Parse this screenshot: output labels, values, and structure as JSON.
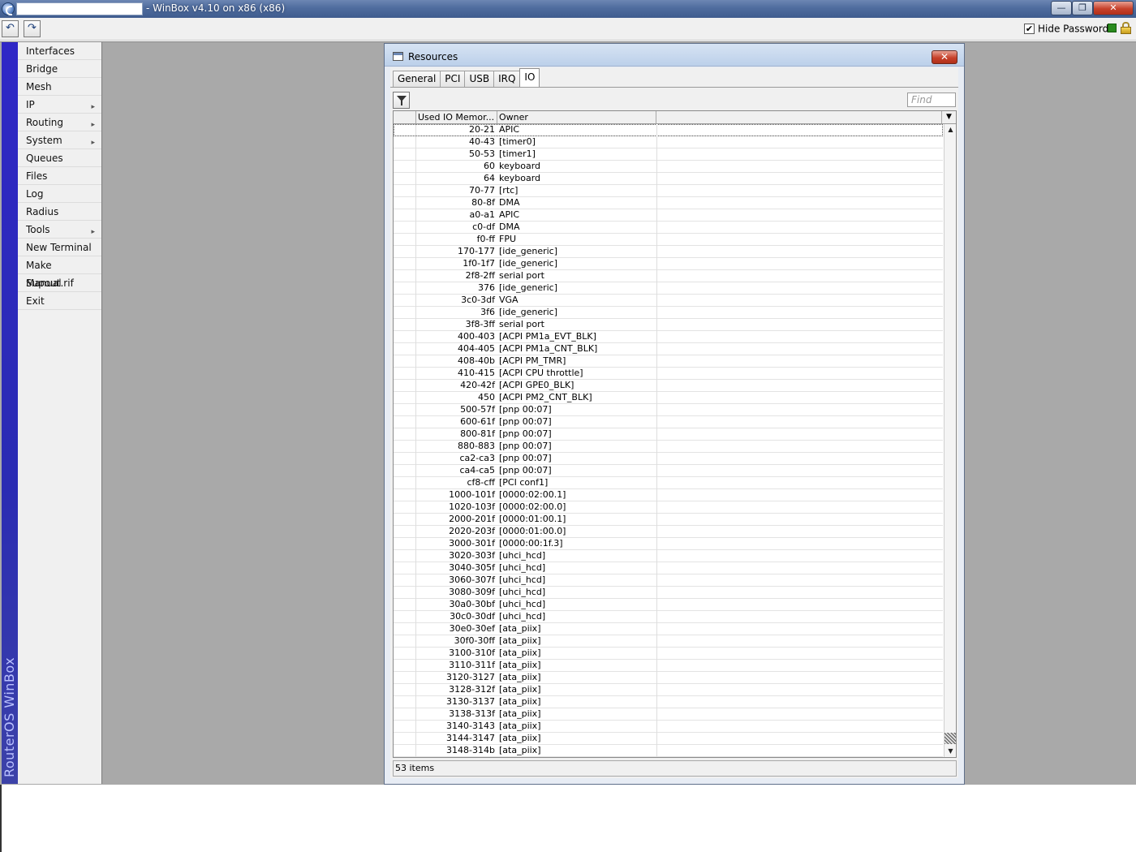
{
  "app": {
    "title": "- WinBox v4.10 on x86 (x86)",
    "hide_passwords_label": "Hide Passwords",
    "hide_passwords_checked": "✔",
    "brand_text": "RouterOS WinBox",
    "min_glyph": "—",
    "max_glyph": "❐",
    "close_glyph": "✕",
    "undo_glyph": "↶",
    "redo_glyph": "↷"
  },
  "menu": {
    "items": [
      {
        "label": "Interfaces",
        "submenu": false
      },
      {
        "label": "Bridge",
        "submenu": false
      },
      {
        "label": "Mesh",
        "submenu": false
      },
      {
        "label": "IP",
        "submenu": true
      },
      {
        "label": "Routing",
        "submenu": true
      },
      {
        "label": "System",
        "submenu": true
      },
      {
        "label": "Queues",
        "submenu": false
      },
      {
        "label": "Files",
        "submenu": false
      },
      {
        "label": "Log",
        "submenu": false
      },
      {
        "label": "Radius",
        "submenu": false
      },
      {
        "label": "Tools",
        "submenu": true
      },
      {
        "label": "New Terminal",
        "submenu": false
      },
      {
        "label": "Make Supout.rif",
        "submenu": false
      },
      {
        "label": "Manual",
        "submenu": false
      },
      {
        "label": "Exit",
        "submenu": false
      }
    ],
    "submenu_glyph": "▸"
  },
  "resources": {
    "title": "Resources",
    "close_glyph": "✕",
    "tabs": [
      "General",
      "PCI",
      "USB",
      "IRQ",
      "IO"
    ],
    "active_tab": "IO",
    "find_placeholder": "Find",
    "columns": {
      "used_io": "Used IO Memor...",
      "owner": "Owner",
      "sort_glyph": "/",
      "menu_glyph": "▼"
    },
    "scroll_up_glyph": "▲",
    "scroll_down_glyph": "▼",
    "status": "53 items",
    "rows": [
      {
        "range": "20-21",
        "owner": "APIC"
      },
      {
        "range": "40-43",
        "owner": "[timer0]"
      },
      {
        "range": "50-53",
        "owner": "[timer1]"
      },
      {
        "range": "60",
        "owner": "keyboard"
      },
      {
        "range": "64",
        "owner": "keyboard"
      },
      {
        "range": "70-77",
        "owner": "[rtc]"
      },
      {
        "range": "80-8f",
        "owner": "DMA"
      },
      {
        "range": "a0-a1",
        "owner": "APIC"
      },
      {
        "range": "c0-df",
        "owner": "DMA"
      },
      {
        "range": "f0-ff",
        "owner": "FPU"
      },
      {
        "range": "170-177",
        "owner": "[ide_generic]"
      },
      {
        "range": "1f0-1f7",
        "owner": "[ide_generic]"
      },
      {
        "range": "2f8-2ff",
        "owner": "serial port"
      },
      {
        "range": "376",
        "owner": "[ide_generic]"
      },
      {
        "range": "3c0-3df",
        "owner": "VGA"
      },
      {
        "range": "3f6",
        "owner": "[ide_generic]"
      },
      {
        "range": "3f8-3ff",
        "owner": "serial port"
      },
      {
        "range": "400-403",
        "owner": "[ACPI PM1a_EVT_BLK]"
      },
      {
        "range": "404-405",
        "owner": "[ACPI PM1a_CNT_BLK]"
      },
      {
        "range": "408-40b",
        "owner": "[ACPI PM_TMR]"
      },
      {
        "range": "410-415",
        "owner": "[ACPI CPU throttle]"
      },
      {
        "range": "420-42f",
        "owner": "[ACPI GPE0_BLK]"
      },
      {
        "range": "450",
        "owner": "[ACPI PM2_CNT_BLK]"
      },
      {
        "range": "500-57f",
        "owner": "[pnp 00:07]"
      },
      {
        "range": "600-61f",
        "owner": "[pnp 00:07]"
      },
      {
        "range": "800-81f",
        "owner": "[pnp 00:07]"
      },
      {
        "range": "880-883",
        "owner": "[pnp 00:07]"
      },
      {
        "range": "ca2-ca3",
        "owner": "[pnp 00:07]"
      },
      {
        "range": "ca4-ca5",
        "owner": "[pnp 00:07]"
      },
      {
        "range": "cf8-cff",
        "owner": "[PCI conf1]"
      },
      {
        "range": "1000-101f",
        "owner": "[0000:02:00.1]"
      },
      {
        "range": "1020-103f",
        "owner": "[0000:02:00.0]"
      },
      {
        "range": "2000-201f",
        "owner": "[0000:01:00.1]"
      },
      {
        "range": "2020-203f",
        "owner": "[0000:01:00.0]"
      },
      {
        "range": "3000-301f",
        "owner": "[0000:00:1f.3]"
      },
      {
        "range": "3020-303f",
        "owner": "[uhci_hcd]"
      },
      {
        "range": "3040-305f",
        "owner": "[uhci_hcd]"
      },
      {
        "range": "3060-307f",
        "owner": "[uhci_hcd]"
      },
      {
        "range": "3080-309f",
        "owner": "[uhci_hcd]"
      },
      {
        "range": "30a0-30bf",
        "owner": "[uhci_hcd]"
      },
      {
        "range": "30c0-30df",
        "owner": "[uhci_hcd]"
      },
      {
        "range": "30e0-30ef",
        "owner": "[ata_piix]"
      },
      {
        "range": "30f0-30ff",
        "owner": "[ata_piix]"
      },
      {
        "range": "3100-310f",
        "owner": "[ata_piix]"
      },
      {
        "range": "3110-311f",
        "owner": "[ata_piix]"
      },
      {
        "range": "3120-3127",
        "owner": "[ata_piix]"
      },
      {
        "range": "3128-312f",
        "owner": "[ata_piix]"
      },
      {
        "range": "3130-3137",
        "owner": "[ata_piix]"
      },
      {
        "range": "3138-313f",
        "owner": "[ata_piix]"
      },
      {
        "range": "3140-3143",
        "owner": "[ata_piix]"
      },
      {
        "range": "3144-3147",
        "owner": "[ata_piix]"
      },
      {
        "range": "3148-314b",
        "owner": "[ata_piix]"
      }
    ]
  }
}
